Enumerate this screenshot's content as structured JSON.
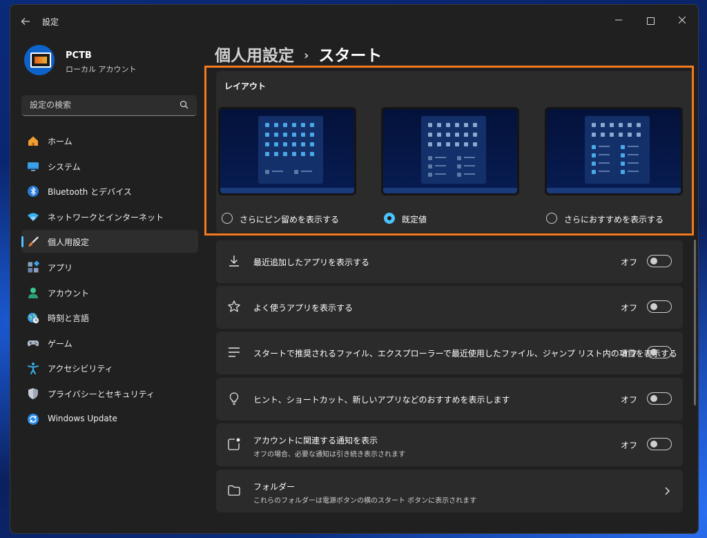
{
  "window": {
    "app_title": "設定",
    "back_icon": "arrow-left-icon",
    "controls": [
      "minimize-icon",
      "maximize-icon",
      "close-icon"
    ]
  },
  "user": {
    "name": "PCTB",
    "account_type": "ローカル アカウント"
  },
  "search": {
    "placeholder": "設定の検索",
    "icon": "search-icon"
  },
  "sidebar": {
    "items": [
      {
        "label": "ホーム",
        "icon": "home-icon",
        "active": false
      },
      {
        "label": "システム",
        "icon": "monitor-icon",
        "active": false
      },
      {
        "label": "Bluetooth とデバイス",
        "icon": "bluetooth-icon",
        "active": false
      },
      {
        "label": "ネットワークとインターネット",
        "icon": "wifi-icon",
        "active": false
      },
      {
        "label": "個人用設定",
        "icon": "brush-icon",
        "active": true
      },
      {
        "label": "アプリ",
        "icon": "apps-icon",
        "active": false
      },
      {
        "label": "アカウント",
        "icon": "person-icon",
        "active": false
      },
      {
        "label": "時刻と言語",
        "icon": "globe-clock-icon",
        "active": false
      },
      {
        "label": "ゲーム",
        "icon": "gamepad-icon",
        "active": false
      },
      {
        "label": "アクセシビリティ",
        "icon": "accessibility-icon",
        "active": false
      },
      {
        "label": "プライバシーとセキュリティ",
        "icon": "shield-icon",
        "active": false
      },
      {
        "label": "Windows Update",
        "icon": "update-icon",
        "active": false
      }
    ]
  },
  "breadcrumb": {
    "parent": "個人用設定",
    "separator": "›",
    "current": "スタート"
  },
  "layout": {
    "title": "レイアウト",
    "options": [
      {
        "label": "さらにピン留めを表示する",
        "selected": false
      },
      {
        "label": "既定値",
        "selected": true
      },
      {
        "label": "さらにおすすめを表示する",
        "selected": false
      }
    ]
  },
  "settings": [
    {
      "title": "最近追加したアプリを表示する",
      "subtitle": "",
      "icon": "download-icon",
      "state": "オフ",
      "control": "toggle"
    },
    {
      "title": "よく使うアプリを表示する",
      "subtitle": "",
      "icon": "star-icon",
      "state": "オフ",
      "control": "toggle"
    },
    {
      "title": "スタートで推奨されるファイル、エクスプローラーで最近使用したファイル、ジャンプ リスト内の項目を表示する",
      "subtitle": "",
      "icon": "list-icon",
      "state": "オフ",
      "control": "toggle"
    },
    {
      "title": "ヒント、ショートカット、新しいアプリなどのおすすめを表示します",
      "subtitle": "",
      "icon": "lightbulb-icon",
      "state": "オフ",
      "control": "toggle"
    },
    {
      "title": "アカウントに関連する通知を表示",
      "subtitle": "オフの場合、必要な通知は引き続き表示されます",
      "icon": "notification-icon",
      "state": "オフ",
      "control": "toggle"
    },
    {
      "title": "フォルダー",
      "subtitle": "これらのフォルダーは電源ボタンの横のスタート ボタンに表示されます",
      "icon": "folder-icon",
      "state": "",
      "control": "chevron"
    }
  ],
  "colors": {
    "accent": "#4cc2ff",
    "highlight_border": "#f47a1f",
    "window_bg": "#202020",
    "card_bg": "#2b2b2b"
  }
}
